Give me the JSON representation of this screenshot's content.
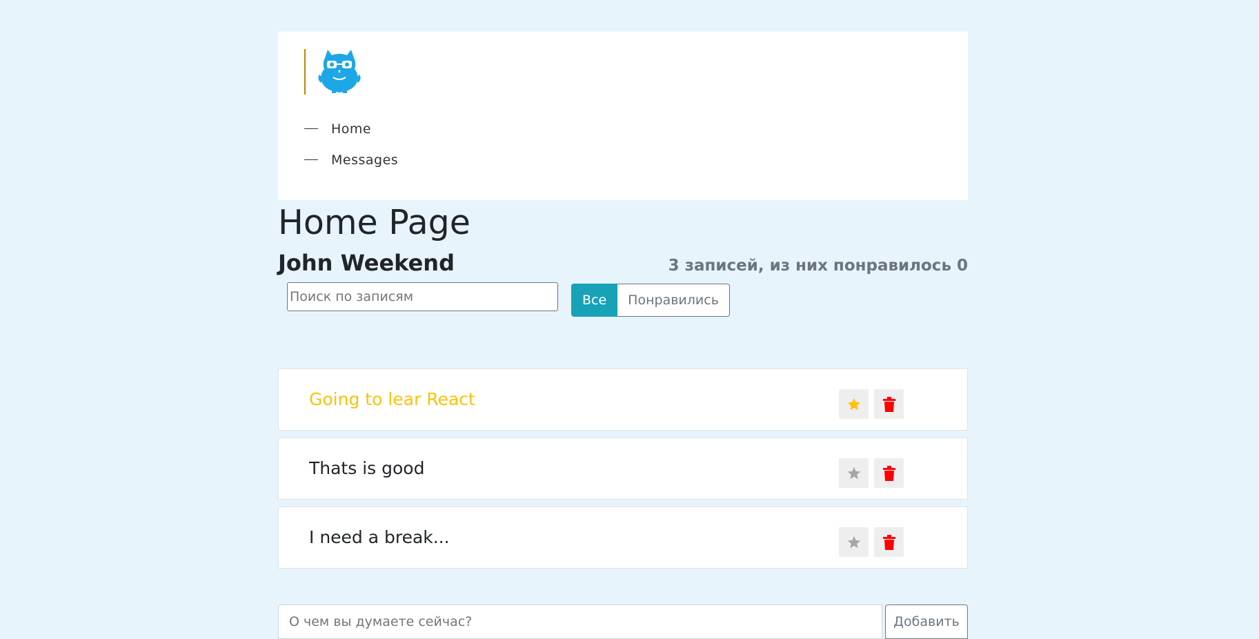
{
  "header": {
    "logo": "owl-mascot-logo",
    "nav": [
      {
        "label": "Home"
      },
      {
        "label": "Messages"
      }
    ]
  },
  "page": {
    "title": "Home Page",
    "user_name": "John Weekend",
    "stats": "3 записей, из них понравилось 0"
  },
  "search": {
    "placeholder": "Поиск по записям"
  },
  "filters": [
    {
      "label": "Все",
      "active": true
    },
    {
      "label": "Понравились",
      "active": false
    }
  ],
  "posts": [
    {
      "label": "Going to lear React",
      "important": true
    },
    {
      "label": "Thats is good",
      "important": false
    },
    {
      "label": "I need a break...",
      "important": false
    }
  ],
  "icons": {
    "star": "star-icon",
    "delete": "trash-icon"
  },
  "colors": {
    "accent": "#17a2b8",
    "important": "#ffc107",
    "delete": "#ff0000",
    "star_inactive": "#a6a6a6",
    "logo": "#1ea7e6",
    "background": "#e8f4fb"
  },
  "add_form": {
    "placeholder": "О чем вы думаете сейчас?",
    "button_label": "Добавить"
  }
}
